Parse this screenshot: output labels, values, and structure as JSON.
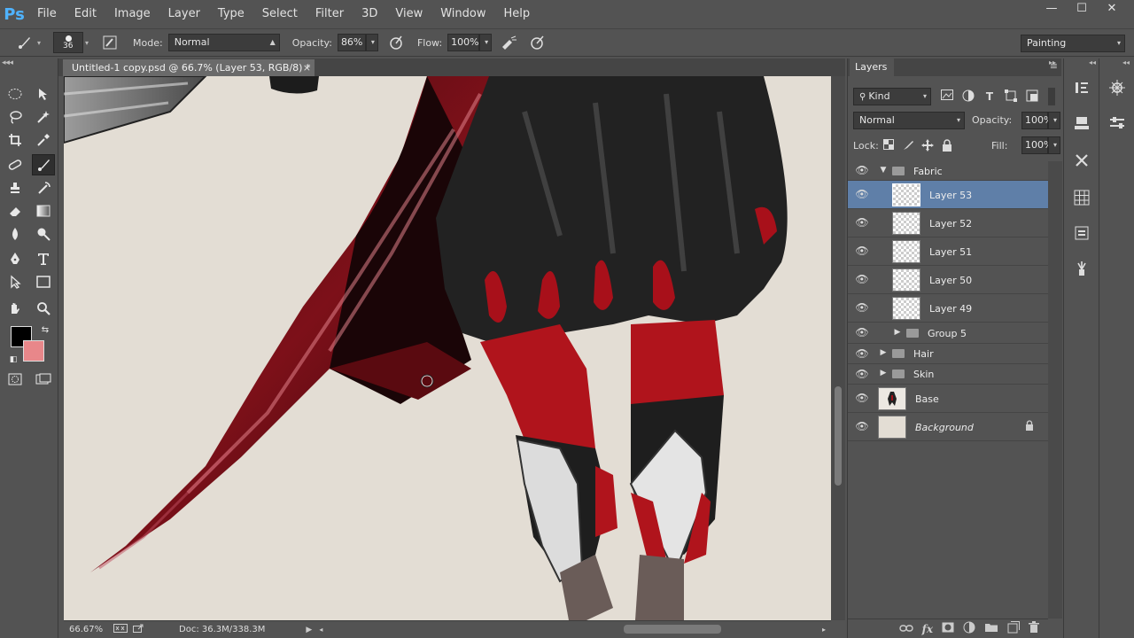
{
  "app": {
    "logo": "Ps"
  },
  "menu": [
    "File",
    "Edit",
    "Image",
    "Layer",
    "Type",
    "Select",
    "Filter",
    "3D",
    "View",
    "Window",
    "Help"
  ],
  "window_controls": {
    "minimize": "—",
    "maximize": "☐",
    "close": "✕"
  },
  "options": {
    "brush_size": "36",
    "mode_label": "Mode:",
    "mode_value": "Normal",
    "opacity_label": "Opacity:",
    "opacity_value": "86%",
    "flow_label": "Flow:",
    "flow_value": "100%",
    "workspace": "Painting"
  },
  "document": {
    "tab_title": "Untitled-1 copy.psd @ 66.7% (Layer 53, RGB/8) *",
    "tab_close": "×",
    "zoom": "66.67%",
    "doc_size": "Doc: 36.3M/338.3M"
  },
  "colors": {
    "foreground": "#000000",
    "background": "#e8878a",
    "selected_layer": "#5f7fa8",
    "canvas_bg": "#e3ddd4"
  },
  "layers_panel": {
    "tab_label": "Layers",
    "filter_kind": "Kind",
    "blend_mode": "Normal",
    "opacity_label": "Opacity:",
    "opacity_value": "100%",
    "lock_label": "Lock:",
    "fill_label": "Fill:",
    "fill_value": "100%",
    "layers": [
      {
        "name": "Fabric",
        "kind": "group",
        "expanded": true,
        "indent": 0
      },
      {
        "name": "Layer 53",
        "kind": "layer",
        "selected": true,
        "indent": 1
      },
      {
        "name": "Layer 52",
        "kind": "layer",
        "indent": 1
      },
      {
        "name": "Layer 51",
        "kind": "layer",
        "indent": 1
      },
      {
        "name": "Layer 50",
        "kind": "layer",
        "indent": 1
      },
      {
        "name": "Layer 49",
        "kind": "layer",
        "indent": 1
      },
      {
        "name": "Group 5",
        "kind": "group",
        "expanded": false,
        "indent": 1
      },
      {
        "name": "Hair",
        "kind": "group",
        "expanded": false,
        "indent": 0
      },
      {
        "name": "Skin",
        "kind": "group",
        "expanded": false,
        "indent": 0
      },
      {
        "name": "Base",
        "kind": "layer",
        "indent": 0
      },
      {
        "name": "Background",
        "kind": "background",
        "locked": true,
        "indent": 0
      }
    ]
  }
}
